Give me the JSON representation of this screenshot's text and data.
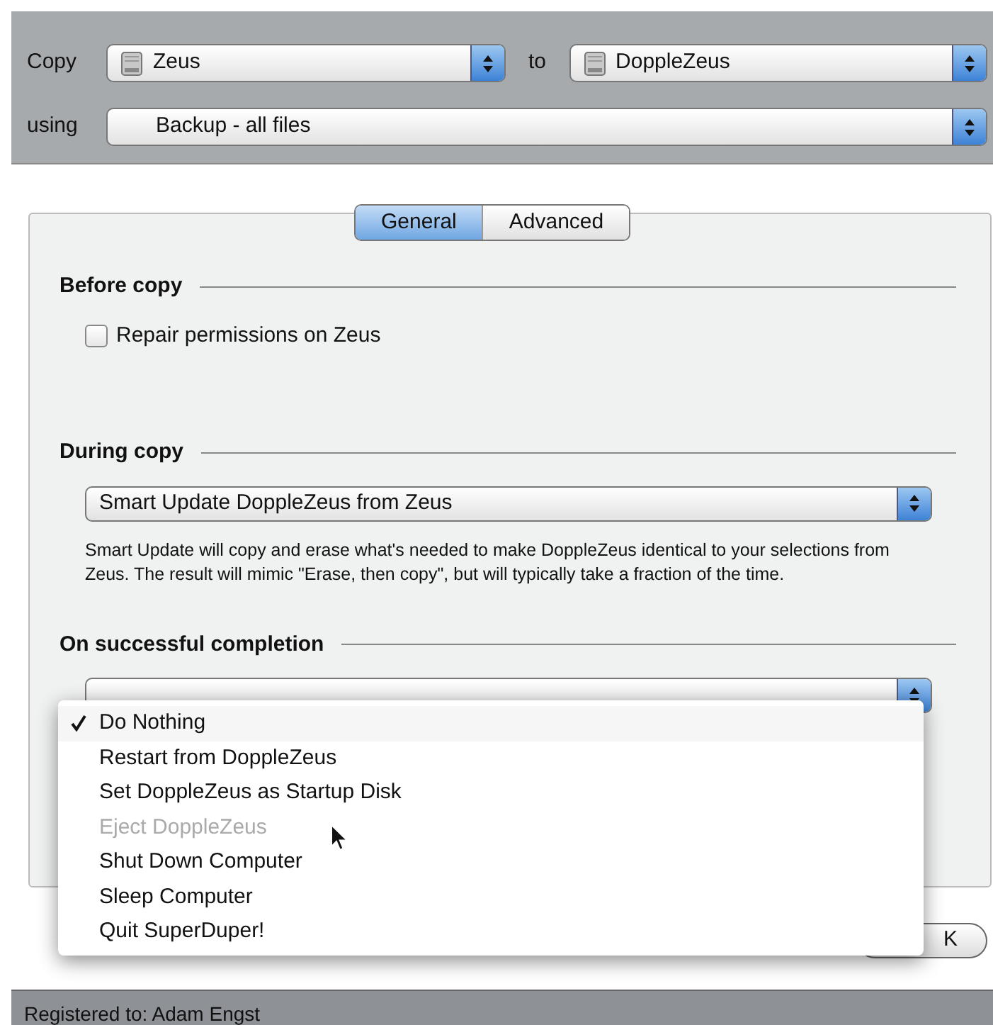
{
  "source_row": {
    "label": "Copy",
    "source": "Zeus",
    "connector": "to",
    "destination": "DoppleZeus"
  },
  "script_row": {
    "label": "using",
    "script": "Backup - all files"
  },
  "tabs": [
    {
      "label": "General",
      "selected": true
    },
    {
      "label": "Advanced",
      "selected": false
    }
  ],
  "before_copy": {
    "heading": "Before copy",
    "checkbox": {
      "label": "Repair permissions on Zeus",
      "checked": false
    }
  },
  "during_copy": {
    "heading": "During copy",
    "popup": "Smart Update DoppleZeus from Zeus",
    "description": "Smart Update will copy and erase what's needed to make DoppleZeus identical to your selections from Zeus. The result will mimic \"Erase, then copy\", but will typically take a fraction of the time."
  },
  "on_completion": {
    "heading": "On successful completion"
  },
  "completion_menu": [
    {
      "label": "Do Nothing",
      "selected": true,
      "disabled": false
    },
    {
      "label": "Restart from DoppleZeus",
      "selected": false,
      "disabled": false
    },
    {
      "label": "Set DoppleZeus as Startup Disk",
      "selected": false,
      "disabled": false
    },
    {
      "label": "Eject DoppleZeus",
      "selected": false,
      "disabled": true
    },
    {
      "label": "Shut Down Computer",
      "selected": false,
      "disabled": false
    },
    {
      "label": "Sleep Computer",
      "selected": false,
      "disabled": false
    },
    {
      "label": "Quit SuperDuper!",
      "selected": false,
      "disabled": false
    }
  ],
  "ok_button": "K",
  "status_bar": "Registered to: Adam Engst"
}
